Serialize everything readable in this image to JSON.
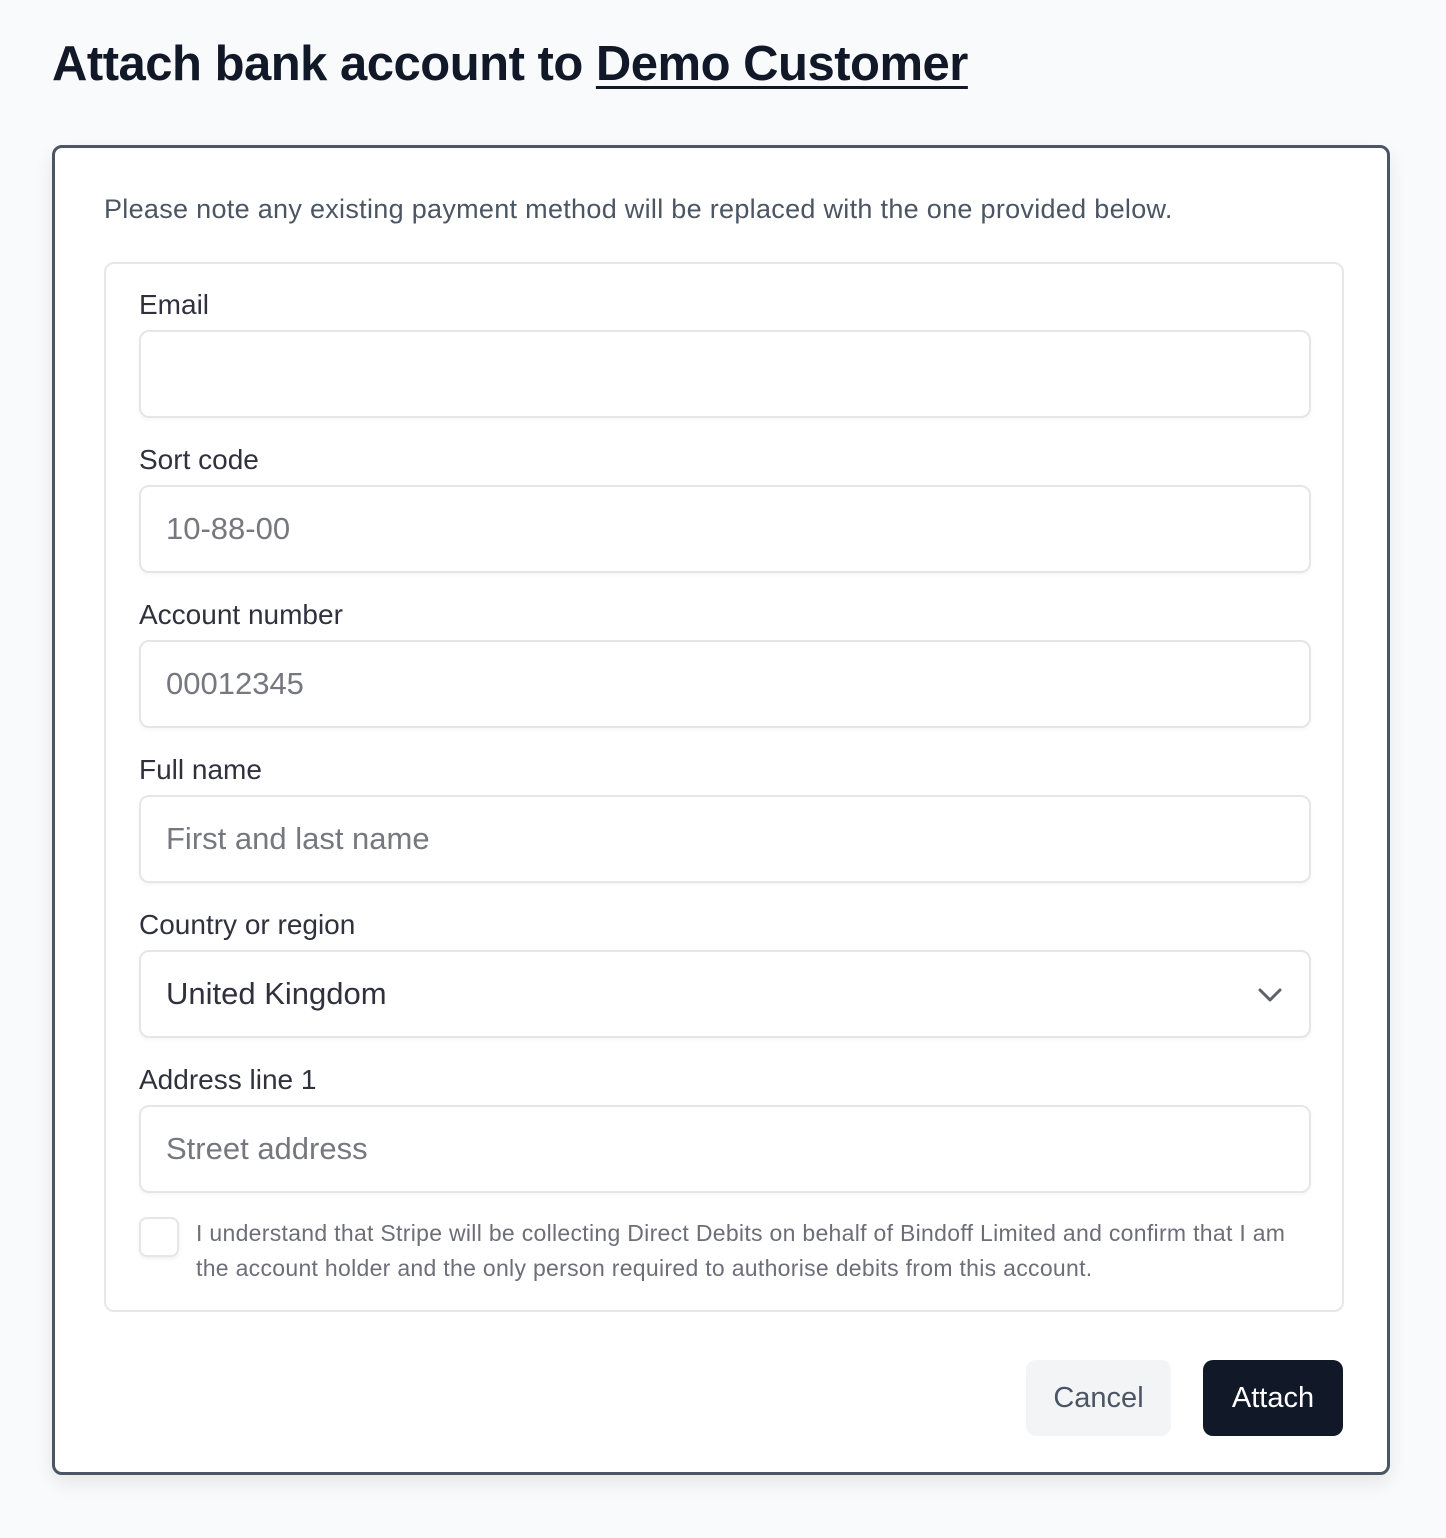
{
  "header": {
    "title_prefix": "Attach bank account to ",
    "customer_link": "Demo Customer"
  },
  "card": {
    "notice": "Please note any existing payment method will be replaced with the one provided below.",
    "form": {
      "email": {
        "label": "Email",
        "value": "",
        "placeholder": ""
      },
      "sort_code": {
        "label": "Sort code",
        "value": "",
        "placeholder": "10-88-00"
      },
      "account_number": {
        "label": "Account number",
        "value": "",
        "placeholder": "00012345"
      },
      "full_name": {
        "label": "Full name",
        "value": "",
        "placeholder": "First and last name"
      },
      "country": {
        "label": "Country or region",
        "selected": "United Kingdom"
      },
      "address_line1": {
        "label": "Address line 1",
        "value": "",
        "placeholder": "Street address"
      },
      "mandate": {
        "checked": false,
        "text": "I understand that Stripe will be collecting Direct Debits on behalf of Bindoff Limited and confirm that I am the account holder and the only person required to authorise debits from this account."
      }
    },
    "actions": {
      "cancel_label": "Cancel",
      "attach_label": "Attach"
    }
  },
  "colors": {
    "primary_button": "#111827",
    "secondary_button": "#f3f4f6",
    "card_border": "#4b5563",
    "page_background": "#f9fafb"
  }
}
